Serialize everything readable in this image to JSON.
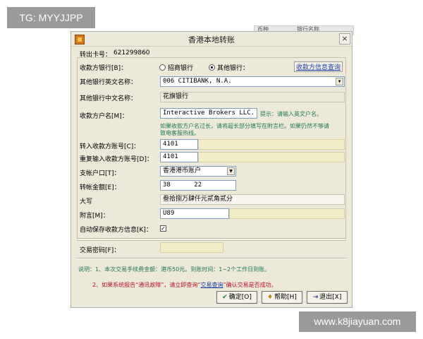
{
  "watermarks": {
    "top_left": "TG: MYYJJPP",
    "bottom_right": "www.k8jiayuan.com"
  },
  "background_table": {
    "col1": "币种",
    "col2": "银行名称"
  },
  "dialog": {
    "title": "香港本地转账",
    "close": "×",
    "card_label": "转出卡号：",
    "card_number": "621299860",
    "payee_bank_label": "收款方银行[B]：",
    "radio_cmb": "招商银行",
    "radio_other": "其他银行：",
    "payee_info_query": "收款方信息查询",
    "other_bank_en_label": "其他银行英文名称：",
    "other_bank_en_value": "006 CITIBANK, N.A.",
    "other_bank_cn_label": "其他银行中文名称：",
    "other_bank_cn_value": "花旗银行",
    "payee_name_label": "收款方户名[M]：",
    "payee_name_value": "Interactive Brokers LLC.",
    "payee_name_tip": "提示：请输入英文户名。",
    "long_name_tip_1": "如果收款方户名过长，请将超长部分填写在附言栏。如果仍然不够请",
    "long_name_tip_2": "致电客服热线。",
    "account_label": "转入收款方账号[C]：",
    "account_value": "4101",
    "account_confirm_label": "重复输入收款方账号[D]：",
    "account_confirm_value": "4101",
    "debit_account_label": "支帐户口[T]：",
    "debit_account_value": "香港港币账户",
    "amount_label": "转帐金额[E]：",
    "amount_value_1": "38",
    "amount_value_2": "22",
    "uppercase_label": "大写",
    "uppercase_value": "叁拾捌万肆仟元贰角贰分",
    "remark_label": "附言[M]：",
    "remark_value": "U89",
    "autosave_label": "自动保存收款方信息[K]：",
    "autosave_mark": "✓",
    "password_label": "交易密码[F]：",
    "note_1": "说明：1、本次交易手续费金额：港币50元。到账时间：1~2个工作日到账。",
    "note_2_a": "2、如果系统报告“通讯故障”，请立即查询“",
    "note_2_link": "交易查询",
    "note_2_b": "”确认交易是否成功。",
    "btn_ok": "确定[O]",
    "btn_help": "帮助[H]",
    "btn_exit": "退出[X]"
  },
  "colors": {
    "dialog_bg": "#ece9d8",
    "hint_green": "#1e7a4e",
    "hint_red": "#c0102a",
    "link_blue": "#1a3ea8",
    "field_beige": "#f3ecc8"
  }
}
